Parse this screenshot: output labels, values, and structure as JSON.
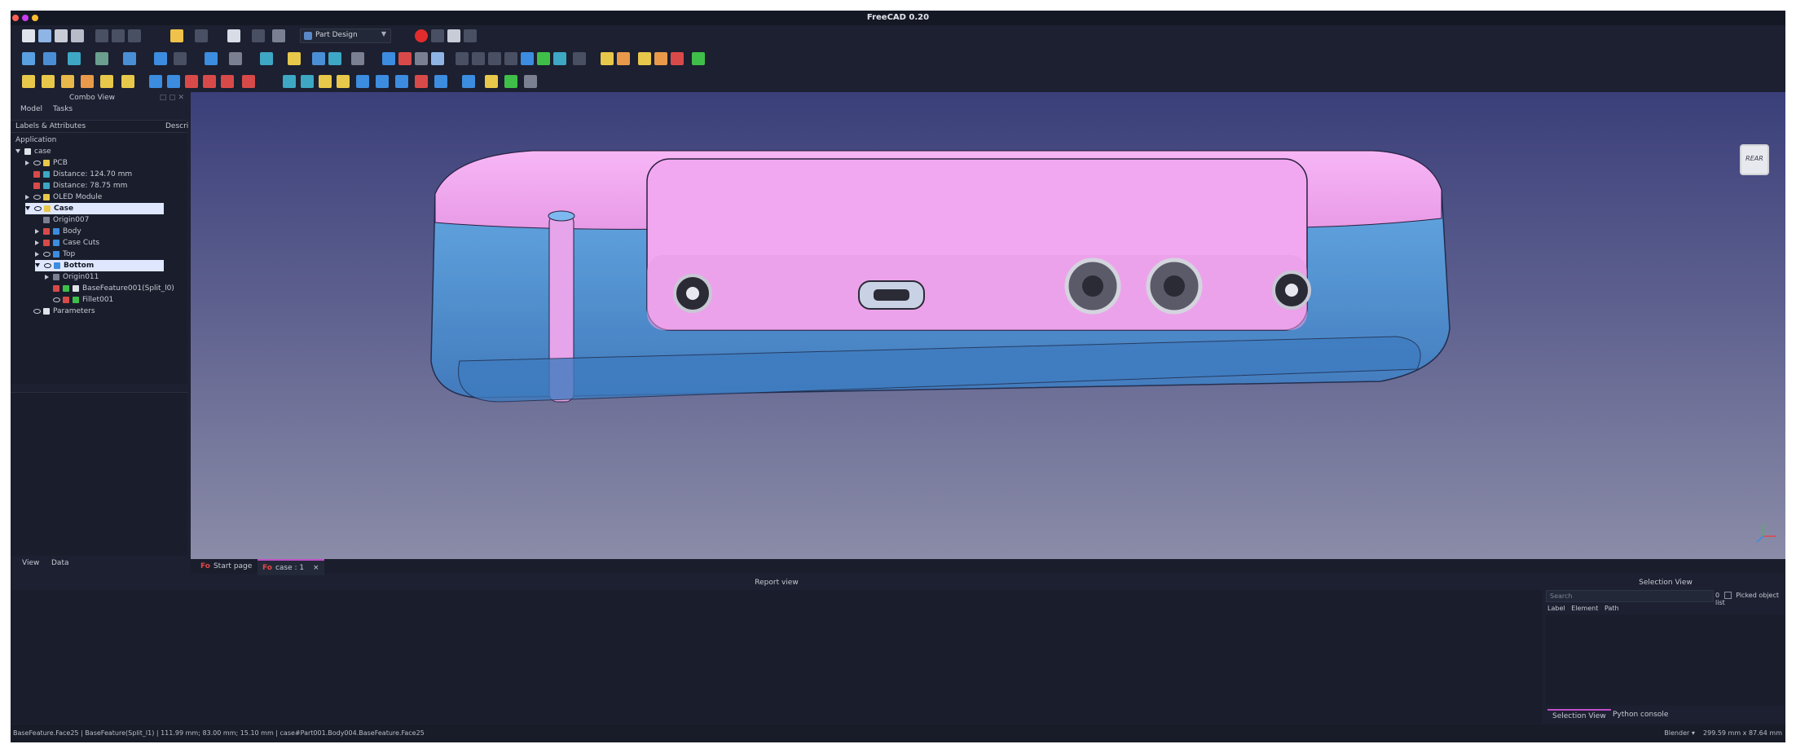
{
  "window": {
    "title": "FreeCAD 0.20"
  },
  "toolbar": {
    "workbench": "Part Design"
  },
  "combo_view": {
    "title": "Combo View",
    "tabs": [
      "Model",
      "Tasks"
    ],
    "tree_header": {
      "labels": "Labels & Attributes",
      "description": "Descri"
    },
    "root_label": "Application",
    "items": [
      {
        "label": "case"
      },
      {
        "label": "PCB"
      },
      {
        "label": "Distance: 124.70  mm"
      },
      {
        "label": "Distance: 78.75  mm"
      },
      {
        "label": "OLED Module"
      },
      {
        "label": "Case"
      },
      {
        "label": "Origin007"
      },
      {
        "label": "Body"
      },
      {
        "label": "Case Cuts"
      },
      {
        "label": "Top"
      },
      {
        "label": "Bottom"
      },
      {
        "label": "Origin011"
      },
      {
        "label": "BaseFeature001(Split_l0)"
      },
      {
        "label": "Fillet001"
      },
      {
        "label": "Parameters"
      }
    ],
    "property_tabs": [
      "View",
      "Data"
    ]
  },
  "viewport": {
    "navcube_face": "REAR",
    "colors": {
      "top_gradient": "#3b3f7a",
      "bottom_gradient": "#8b8ca8",
      "case_blue": "#5aa4e8",
      "case_pink": "#f3a6f0"
    }
  },
  "doc_tabs": [
    {
      "label": "Start page",
      "close": "×"
    },
    {
      "label": "case : 1",
      "close": "×"
    }
  ],
  "report_view": {
    "title": "Report view"
  },
  "selection_view": {
    "title": "Selection View",
    "search_placeholder": "Search",
    "picked_count": "0",
    "picked_label": "Picked object list",
    "columns": [
      "Label",
      "Element",
      "Path"
    ],
    "tabs": [
      "Selection View",
      "Python console"
    ]
  },
  "status_bar": {
    "left": "BaseFeature.Face25 | BaseFeature(Split_l1) | 111.99 mm; 83.00 mm; 15.10 mm | case#Part001.Body004.BaseFeature.Face25",
    "nav_style": "Blender",
    "dimensions": "299.59 mm x 87.64 mm"
  }
}
